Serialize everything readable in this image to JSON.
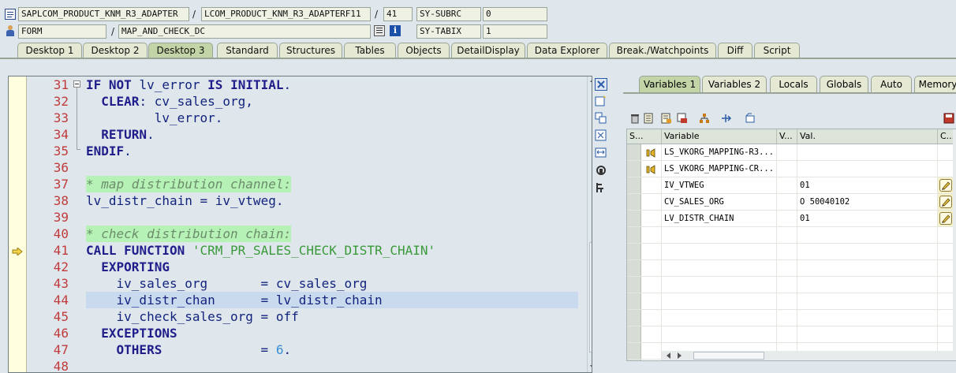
{
  "header": {
    "row1": {
      "program": "SAPLCOM_PRODUCT_KNM_R3_ADAPTER",
      "include": "LCOM_PRODUCT_KNM_R3_ADAPTERF11",
      "line": "41",
      "sysfield_name": "SY-SUBRC",
      "sysfield_value": "0",
      "sep1": "/",
      "sep2": "/"
    },
    "row2": {
      "type": "FORM",
      "name": "MAP_AND_CHECK_DC",
      "sysfield_name": "SY-TABIX",
      "sysfield_value": "1",
      "sep1": "/"
    }
  },
  "desktop_tabs": [
    "Desktop 1",
    "Desktop 2",
    "Desktop 3",
    "Standard",
    "Structures",
    "Tables",
    "Objects",
    "DetailDisplay",
    "Data Explorer",
    "Break./Watchpoints",
    "Diff",
    "Script"
  ],
  "active_desktop_tab": "Desktop 3",
  "editor": {
    "current_line": "41",
    "highlighted_line": "44",
    "lines": [
      {
        "num": "31",
        "code": "IF NOT lv_error IS INITIAL."
      },
      {
        "num": "32",
        "code": "  CLEAR: cv_sales_org,"
      },
      {
        "num": "33",
        "code": "         lv_error."
      },
      {
        "num": "34",
        "code": "  RETURN."
      },
      {
        "num": "35",
        "code": "ENDIF."
      },
      {
        "num": "36",
        "code": ""
      },
      {
        "num": "37",
        "code": "* map distribution channel:"
      },
      {
        "num": "38",
        "code": "lv_distr_chain = iv_vtweg."
      },
      {
        "num": "39",
        "code": ""
      },
      {
        "num": "40",
        "code": "* check distribution chain:"
      },
      {
        "num": "41",
        "code": "CALL FUNCTION 'CRM_PR_SALES_CHECK_DISTR_CHAIN'"
      },
      {
        "num": "42",
        "code": "  EXPORTING"
      },
      {
        "num": "43",
        "code": "    iv_sales_org       = cv_sales_org"
      },
      {
        "num": "44",
        "code": "    iv_distr_chan      = lv_distr_chain"
      },
      {
        "num": "45",
        "code": "    iv_check_sales_org = off"
      },
      {
        "num": "46",
        "code": "  EXCEPTIONS"
      },
      {
        "num": "47",
        "code": "    OTHERS             = 6."
      },
      {
        "num": "48",
        "code": ""
      }
    ]
  },
  "variables_panel": {
    "tabs": [
      "Variables 1",
      "Variables 2",
      "Locals",
      "Globals",
      "Auto",
      "Memory"
    ],
    "active_tab": "Variables 1",
    "columns": [
      "S...",
      "Variable",
      "V...",
      "Val.",
      "C..."
    ],
    "rows": [
      {
        "variable": "LS_VKORG_MAPPING-R3...",
        "value": "",
        "icon": "structure-icon",
        "change": false
      },
      {
        "variable": "LS_VKORG_MAPPING-CR...",
        "value": "",
        "icon": "structure-icon",
        "change": false
      },
      {
        "variable": "IV_VTWEG",
        "value": "01",
        "icon": "",
        "change": true
      },
      {
        "variable": "CV_SALES_ORG",
        "value": "O 50040102",
        "icon": "",
        "change": true
      },
      {
        "variable": "LV_DISTR_CHAIN",
        "value": "01",
        "icon": "",
        "change": true
      }
    ],
    "empty_rows": 9
  },
  "colors": {
    "keyword": "#1f1e8a",
    "string": "#3a9a3a",
    "number": "#3a8fd8",
    "comment_bg": "#b6f2b6",
    "line_number": "#c03b3b",
    "active_tab": "#c3d4a6",
    "highlight_line": "#c9d9ee"
  }
}
